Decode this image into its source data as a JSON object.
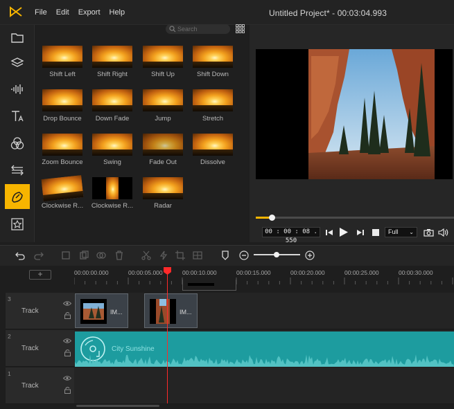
{
  "app": {
    "title": "Untitled Project* - 00:03:04.993",
    "menu": [
      "File",
      "Edit",
      "Export",
      "Help"
    ]
  },
  "sidebar": {
    "icons": [
      "folder-icon",
      "layers-icon",
      "audio-wave-icon",
      "text-icon",
      "filter-icon",
      "transition-icon",
      "motion-icon",
      "sticker-icon"
    ],
    "active": "motion-icon",
    "accent": "#f7b500"
  },
  "library": {
    "search_placeholder": "Search",
    "items": [
      {
        "label": "Shift Left"
      },
      {
        "label": "Shift Right"
      },
      {
        "label": "Shift Up"
      },
      {
        "label": "Shift Down"
      },
      {
        "label": "Drop Bounce"
      },
      {
        "label": "Down Fade"
      },
      {
        "label": "Jump"
      },
      {
        "label": "Stretch"
      },
      {
        "label": "Zoom Bounce"
      },
      {
        "label": "Swing"
      },
      {
        "label": "Fade Out"
      },
      {
        "label": "Dissolve"
      },
      {
        "label": "Clockwise R..."
      },
      {
        "label": "Clockwise R..."
      },
      {
        "label": "Radar"
      }
    ]
  },
  "preview": {
    "timecode": "00 : 00 : 08 . 550",
    "quality": "Full",
    "progress_fraction": 0.08
  },
  "timeline": {
    "ruler": [
      "00:00:00.000",
      "00:00:05.000",
      "00:00:10.000",
      "00:00:15.000",
      "00:00:20.000",
      "00:00:25.000",
      "00:00:30.000"
    ],
    "add_track": "+",
    "tracks": [
      {
        "num": "3",
        "name": "Track"
      },
      {
        "num": "2",
        "name": "Track"
      },
      {
        "num": "1",
        "name": "Track"
      }
    ],
    "video_clips": [
      {
        "label": "IM..."
      },
      {
        "label": "IM..."
      }
    ],
    "audio_clip": {
      "label": "City Sunshine",
      "color": "#1d9c9f"
    },
    "playhead_color": "#ff2a2a"
  }
}
